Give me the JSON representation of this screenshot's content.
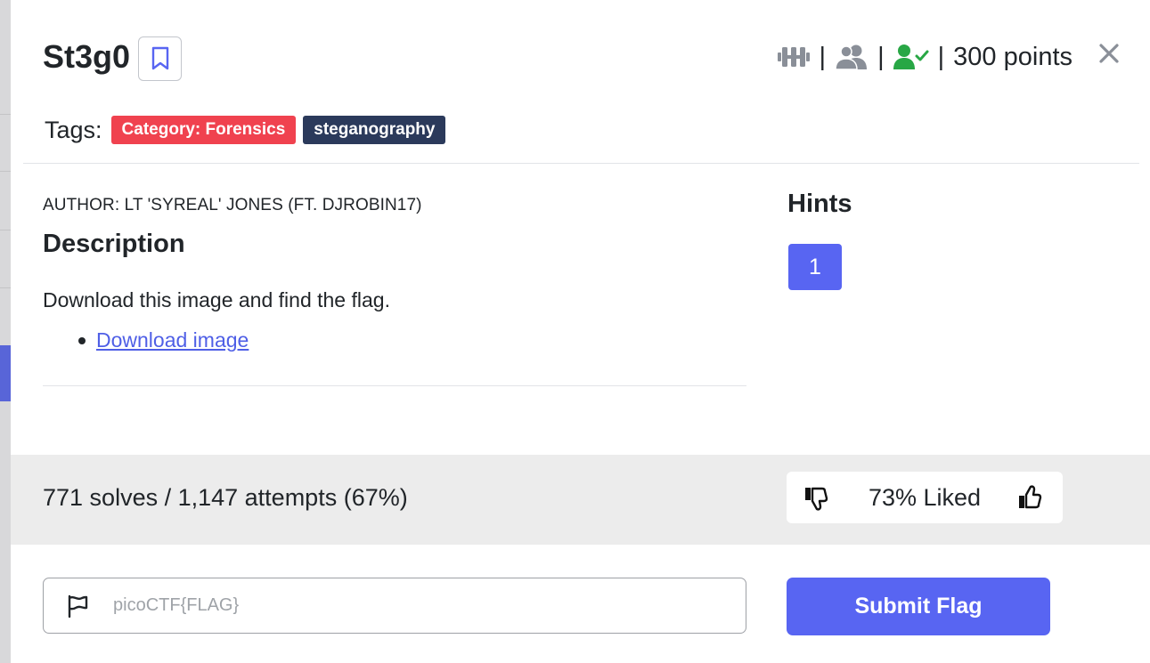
{
  "challenge": {
    "title": "St3g0",
    "points": "300 points",
    "meta_separator": "|",
    "tags_label": "Tags:",
    "tags": [
      "Category: Forensics",
      "steganography"
    ]
  },
  "description": {
    "author": "AUTHOR: LT 'SYREAL' JONES (FT. DJROBIN17)",
    "heading": "Description",
    "text": "Download this image and find the flag.",
    "link_label": "Download image"
  },
  "hints": {
    "heading": "Hints",
    "buttons": [
      "1"
    ]
  },
  "stats": {
    "solves_text": "771 solves / 1,147 attempts (67%)",
    "liked_text": "73% Liked"
  },
  "flag_form": {
    "placeholder": "picoCTF{FLAG}",
    "value": "",
    "submit_label": "Submit Flag"
  },
  "icons": {
    "bookmark": "bookmark-icon",
    "difficulty": "dumbbell-icon",
    "users": "users-icon",
    "solved": "user-check-icon",
    "close": "close-icon",
    "dislike": "thumbs-down-icon",
    "like": "thumbs-up-icon",
    "flag": "flag-icon"
  },
  "colors": {
    "primary": "#5865f2",
    "category_tag": "#f0424f",
    "tag_dark": "#2b3a5b",
    "solved_green": "#28a745",
    "icon_gray": "#8a8f98",
    "link": "#4f5fe6",
    "stats_band": "#ececec"
  }
}
